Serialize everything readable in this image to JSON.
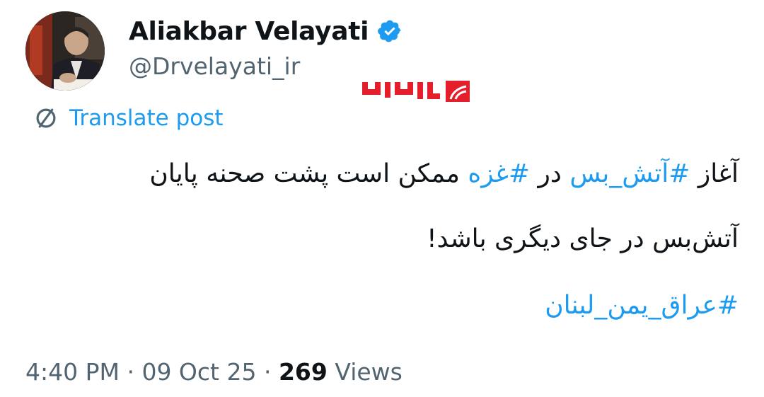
{
  "author": {
    "display_name": "Aliakbar Velayati",
    "handle": "@Drvelayati_ir",
    "verified": true,
    "verified_icon": "verified-badge-icon",
    "avatar_icon": "profile-photo"
  },
  "watermark": {
    "text": "ایران۲۴"
  },
  "translate": {
    "label": "Translate post",
    "icon": "globe-slash-icon"
  },
  "post": {
    "line1_prefix": "آغاز ",
    "line1_hashtag1": "#آتش_بس",
    "line1_middle": " در ",
    "line1_hashtag2": "#غزه",
    "line1_suffix": " ممکن است پشت صحنه پایان",
    "line2": "آتش‌بس در جای دیگری باشد!",
    "line3_hashtag": "#عراق_یمن_لبنان"
  },
  "meta": {
    "time": "4:40 PM",
    "separator1": " · ",
    "date": "09 Oct 25",
    "separator2": " · ",
    "views_count": "269",
    "views_label": " Views"
  },
  "colors": {
    "link": "#1d9bf0",
    "text": "#0f1419",
    "secondary": "#536471",
    "watermark": "#e41e2b"
  }
}
